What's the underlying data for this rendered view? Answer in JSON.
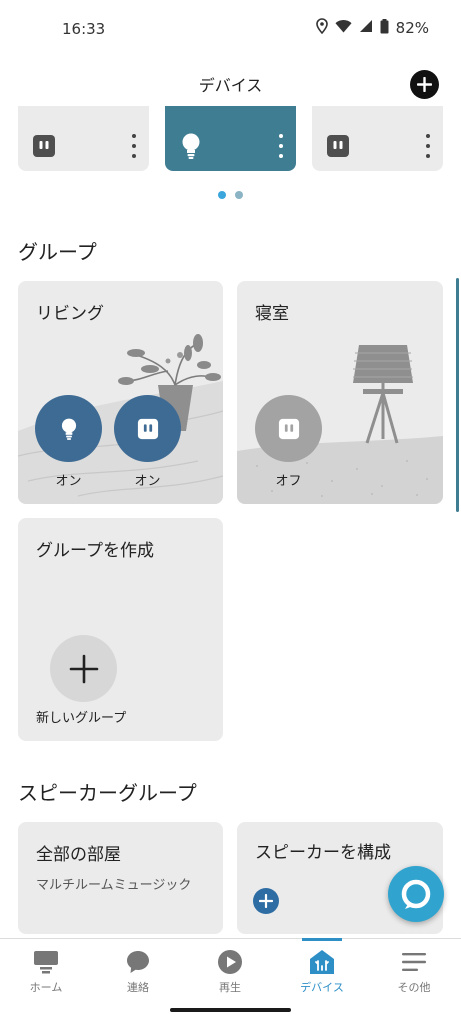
{
  "status_bar": {
    "time": "16:33",
    "battery": "82%"
  },
  "header": {
    "title": "デバイス",
    "add_icon": "plus-icon"
  },
  "devices_carousel": {
    "cards": [
      {
        "icon": "plug-icon",
        "active": false
      },
      {
        "icon": "bulb-icon",
        "active": true
      },
      {
        "icon": "plug-icon",
        "active": false
      }
    ],
    "page_dots": 2,
    "dot_colors": [
      "#3aa6dc",
      "#8ab3c4"
    ]
  },
  "groups": {
    "title": "グループ",
    "cards": [
      {
        "name": "リビング",
        "toggles": [
          {
            "icon": "bulb-icon",
            "state": "オン"
          },
          {
            "icon": "plug-icon",
            "state": "オン"
          }
        ]
      },
      {
        "name": "寝室",
        "toggles": [
          {
            "icon": "plug-icon",
            "state": "オフ"
          }
        ]
      }
    ],
    "create": {
      "title": "グループを作成",
      "button_label": "新しいグループ"
    }
  },
  "speaker_groups": {
    "title": "スピーカーグループ",
    "cards": [
      {
        "name": "全部の部屋",
        "subtitle": "マルチルームミュージック"
      },
      {
        "name": "スピーカーを構成"
      }
    ]
  },
  "bottom_nav": {
    "items": [
      {
        "label": "ホーム",
        "icon": "home-icon"
      },
      {
        "label": "連絡",
        "icon": "chat-icon"
      },
      {
        "label": "再生",
        "icon": "play-icon"
      },
      {
        "label": "デバイス",
        "icon": "devices-icon",
        "active": true
      },
      {
        "label": "その他",
        "icon": "menu-icon"
      }
    ]
  },
  "colors": {
    "accent": "#3f7d93",
    "toggle_on": "#3e6b94",
    "toggle_off": "#a3a3a3",
    "nav_active": "#2e8fc7",
    "alexa": "#30a4cf"
  }
}
